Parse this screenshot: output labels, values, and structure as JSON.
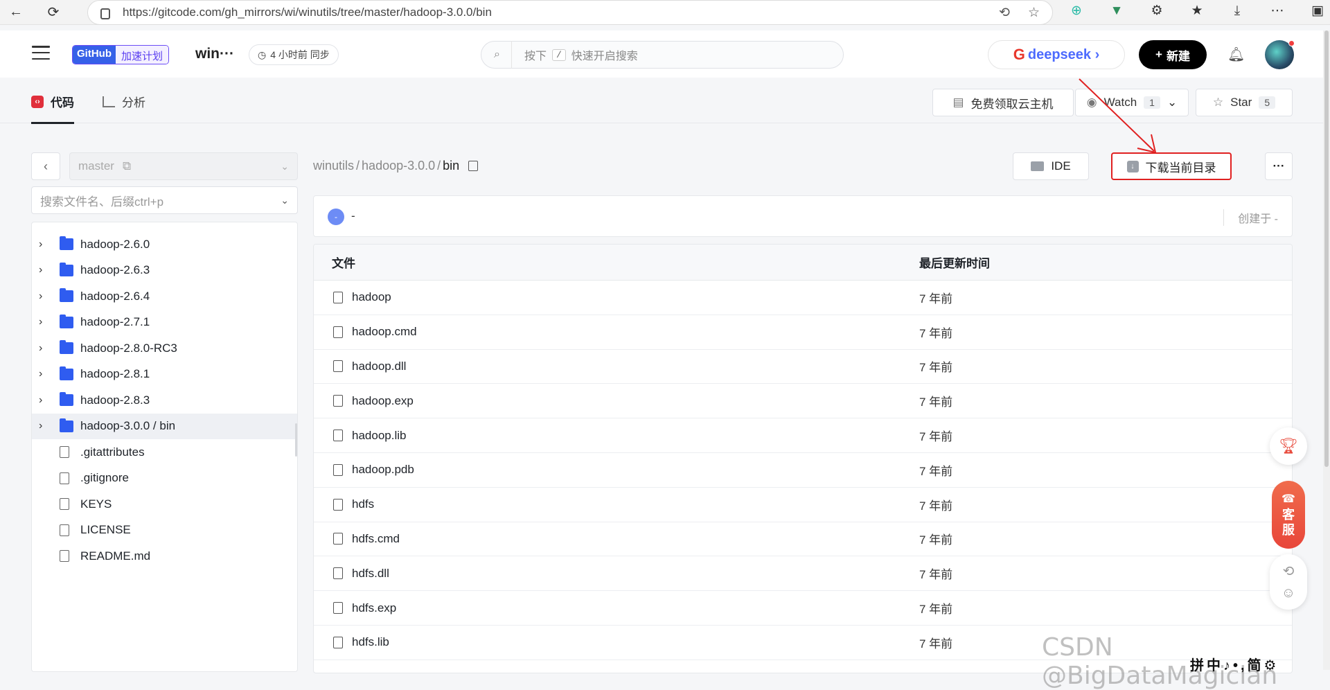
{
  "browser": {
    "url": "https://gitcode.com/gh_mirrors/wi/winutils/tree/master/hadoop-3.0.0/bin",
    "back_icon": "←",
    "reload_icon": "⟳",
    "ext_icons": [
      "⊕",
      "▼",
      "⚙",
      "★",
      "⤓",
      "⋯",
      "▣"
    ]
  },
  "header": {
    "badge_github": "GitHub",
    "badge_program": "加速计划",
    "repo_name": "win···",
    "sync_text": "4 小时前 同步",
    "search_prefix": "按下",
    "search_key": "/",
    "search_suffix": "快速开启搜索",
    "deepseek_label": "deepseek ›",
    "new_button": "新建"
  },
  "tabs": [
    {
      "label": "代码"
    },
    {
      "label": "分析"
    }
  ],
  "repo_actions": {
    "free_cloud": "免费领取云主机",
    "watch_label": "Watch",
    "watch_count": "1",
    "star_label": "Star",
    "star_count": "5"
  },
  "sidebar": {
    "branch": "master",
    "search_placeholder": "搜索文件名、后缀ctrl+p",
    "tree": [
      {
        "type": "folder",
        "label": "hadoop-2.6.0"
      },
      {
        "type": "folder",
        "label": "hadoop-2.6.3"
      },
      {
        "type": "folder",
        "label": "hadoop-2.6.4"
      },
      {
        "type": "folder",
        "label": "hadoop-2.7.1"
      },
      {
        "type": "folder",
        "label": "hadoop-2.8.0-RC3"
      },
      {
        "type": "folder",
        "label": "hadoop-2.8.1"
      },
      {
        "type": "folder",
        "label": "hadoop-2.8.3"
      },
      {
        "type": "folder",
        "label": "hadoop-3.0.0 / bin",
        "selected": true
      },
      {
        "type": "file",
        "label": ".gitattributes"
      },
      {
        "type": "file",
        "label": ".gitignore"
      },
      {
        "type": "file",
        "label": "KEYS"
      },
      {
        "type": "file",
        "label": "LICENSE"
      },
      {
        "type": "file",
        "label": "README.md"
      }
    ]
  },
  "main": {
    "breadcrumb": {
      "root": "winutils",
      "sep": "/",
      "mid": "hadoop-3.0.0",
      "current": "bin"
    },
    "ide_button": "IDE",
    "download_button": "下载当前目录",
    "more_button": "···",
    "commit": {
      "avatar": "-",
      "message": "-",
      "created": "创建于 -"
    },
    "table": {
      "col_file": "文件",
      "col_time": "最后更新时间",
      "rows": [
        {
          "name": "hadoop",
          "time": "7 年前"
        },
        {
          "name": "hadoop.cmd",
          "time": "7 年前"
        },
        {
          "name": "hadoop.dll",
          "time": "7 年前"
        },
        {
          "name": "hadoop.exp",
          "time": "7 年前"
        },
        {
          "name": "hadoop.lib",
          "time": "7 年前"
        },
        {
          "name": "hadoop.pdb",
          "time": "7 年前"
        },
        {
          "name": "hdfs",
          "time": "7 年前"
        },
        {
          "name": "hdfs.cmd",
          "time": "7 年前"
        },
        {
          "name": "hdfs.dll",
          "time": "7 年前"
        },
        {
          "name": "hdfs.exp",
          "time": "7 年前"
        },
        {
          "name": "hdfs.lib",
          "time": "7 年前"
        }
      ]
    }
  },
  "float": {
    "service_1": "客",
    "service_2": "服"
  },
  "watermark": "CSDN @BigDataMagician",
  "ime": "拼中♪•,简⚙"
}
